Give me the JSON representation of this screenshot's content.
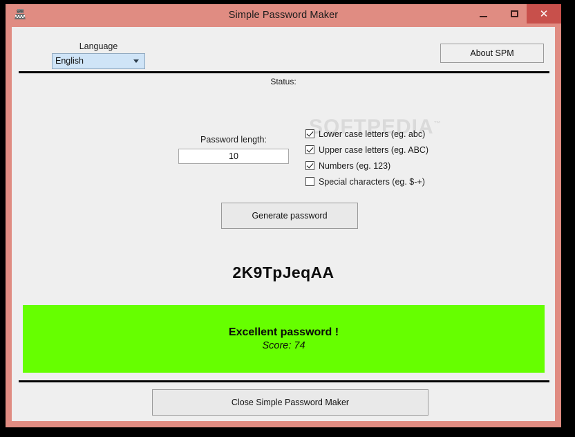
{
  "window": {
    "title": "Simple Password Maker",
    "icon": "app-icon",
    "frame_color": "#e08c82",
    "client_color": "#efefef",
    "controls": {
      "minimize": "–",
      "maximize": "□",
      "close": "✕",
      "close_bg": "#c8504b"
    }
  },
  "toolbar": {
    "language_label": "Language",
    "language_selected": "English",
    "language_options": [
      "English"
    ],
    "about_label": "About SPM",
    "dropdown_icon": "chevron-down-icon"
  },
  "status": {
    "label": "Status:"
  },
  "settings": {
    "length_label": "Password length:",
    "length_value": "10",
    "options": [
      {
        "label": "Lower case letters (eg. abc)",
        "checked": true
      },
      {
        "label": "Upper case letters (eg. ABC)",
        "checked": true
      },
      {
        "label": "Numbers (eg. 123)",
        "checked": true
      },
      {
        "label": "Special characters (eg. $-+)",
        "checked": false
      }
    ]
  },
  "actions": {
    "generate_label": "Generate password",
    "close_label": "Close Simple Password Maker"
  },
  "result": {
    "password": "2K9TpJeqAA",
    "verdict": "Excellent password !",
    "score_text": "Score: 74",
    "score_number": 74,
    "panel_color": "#66ff00"
  },
  "watermark": {
    "text": "SOFTPEDIA",
    "mark": "™"
  }
}
